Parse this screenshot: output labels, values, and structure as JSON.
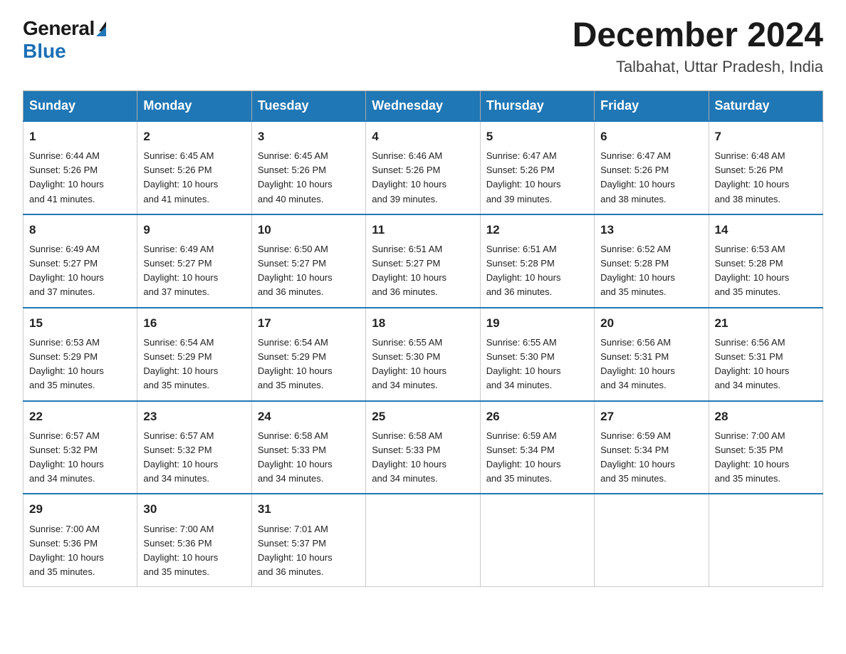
{
  "logo": {
    "general": "General",
    "blue": "Blue",
    "triangle": "▲"
  },
  "title": "December 2024",
  "location": "Talbahat, Uttar Pradesh, India",
  "days_of_week": [
    "Sunday",
    "Monday",
    "Tuesday",
    "Wednesday",
    "Thursday",
    "Friday",
    "Saturday"
  ],
  "weeks": [
    [
      {
        "day": "1",
        "sunrise": "6:44 AM",
        "sunset": "5:26 PM",
        "daylight": "10 hours and 41 minutes."
      },
      {
        "day": "2",
        "sunrise": "6:45 AM",
        "sunset": "5:26 PM",
        "daylight": "10 hours and 41 minutes."
      },
      {
        "day": "3",
        "sunrise": "6:45 AM",
        "sunset": "5:26 PM",
        "daylight": "10 hours and 40 minutes."
      },
      {
        "day": "4",
        "sunrise": "6:46 AM",
        "sunset": "5:26 PM",
        "daylight": "10 hours and 39 minutes."
      },
      {
        "day": "5",
        "sunrise": "6:47 AM",
        "sunset": "5:26 PM",
        "daylight": "10 hours and 39 minutes."
      },
      {
        "day": "6",
        "sunrise": "6:47 AM",
        "sunset": "5:26 PM",
        "daylight": "10 hours and 38 minutes."
      },
      {
        "day": "7",
        "sunrise": "6:48 AM",
        "sunset": "5:26 PM",
        "daylight": "10 hours and 38 minutes."
      }
    ],
    [
      {
        "day": "8",
        "sunrise": "6:49 AM",
        "sunset": "5:27 PM",
        "daylight": "10 hours and 37 minutes."
      },
      {
        "day": "9",
        "sunrise": "6:49 AM",
        "sunset": "5:27 PM",
        "daylight": "10 hours and 37 minutes."
      },
      {
        "day": "10",
        "sunrise": "6:50 AM",
        "sunset": "5:27 PM",
        "daylight": "10 hours and 36 minutes."
      },
      {
        "day": "11",
        "sunrise": "6:51 AM",
        "sunset": "5:27 PM",
        "daylight": "10 hours and 36 minutes."
      },
      {
        "day": "12",
        "sunrise": "6:51 AM",
        "sunset": "5:28 PM",
        "daylight": "10 hours and 36 minutes."
      },
      {
        "day": "13",
        "sunrise": "6:52 AM",
        "sunset": "5:28 PM",
        "daylight": "10 hours and 35 minutes."
      },
      {
        "day": "14",
        "sunrise": "6:53 AM",
        "sunset": "5:28 PM",
        "daylight": "10 hours and 35 minutes."
      }
    ],
    [
      {
        "day": "15",
        "sunrise": "6:53 AM",
        "sunset": "5:29 PM",
        "daylight": "10 hours and 35 minutes."
      },
      {
        "day": "16",
        "sunrise": "6:54 AM",
        "sunset": "5:29 PM",
        "daylight": "10 hours and 35 minutes."
      },
      {
        "day": "17",
        "sunrise": "6:54 AM",
        "sunset": "5:29 PM",
        "daylight": "10 hours and 35 minutes."
      },
      {
        "day": "18",
        "sunrise": "6:55 AM",
        "sunset": "5:30 PM",
        "daylight": "10 hours and 34 minutes."
      },
      {
        "day": "19",
        "sunrise": "6:55 AM",
        "sunset": "5:30 PM",
        "daylight": "10 hours and 34 minutes."
      },
      {
        "day": "20",
        "sunrise": "6:56 AM",
        "sunset": "5:31 PM",
        "daylight": "10 hours and 34 minutes."
      },
      {
        "day": "21",
        "sunrise": "6:56 AM",
        "sunset": "5:31 PM",
        "daylight": "10 hours and 34 minutes."
      }
    ],
    [
      {
        "day": "22",
        "sunrise": "6:57 AM",
        "sunset": "5:32 PM",
        "daylight": "10 hours and 34 minutes."
      },
      {
        "day": "23",
        "sunrise": "6:57 AM",
        "sunset": "5:32 PM",
        "daylight": "10 hours and 34 minutes."
      },
      {
        "day": "24",
        "sunrise": "6:58 AM",
        "sunset": "5:33 PM",
        "daylight": "10 hours and 34 minutes."
      },
      {
        "day": "25",
        "sunrise": "6:58 AM",
        "sunset": "5:33 PM",
        "daylight": "10 hours and 34 minutes."
      },
      {
        "day": "26",
        "sunrise": "6:59 AM",
        "sunset": "5:34 PM",
        "daylight": "10 hours and 35 minutes."
      },
      {
        "day": "27",
        "sunrise": "6:59 AM",
        "sunset": "5:34 PM",
        "daylight": "10 hours and 35 minutes."
      },
      {
        "day": "28",
        "sunrise": "7:00 AM",
        "sunset": "5:35 PM",
        "daylight": "10 hours and 35 minutes."
      }
    ],
    [
      {
        "day": "29",
        "sunrise": "7:00 AM",
        "sunset": "5:36 PM",
        "daylight": "10 hours and 35 minutes."
      },
      {
        "day": "30",
        "sunrise": "7:00 AM",
        "sunset": "5:36 PM",
        "daylight": "10 hours and 35 minutes."
      },
      {
        "day": "31",
        "sunrise": "7:01 AM",
        "sunset": "5:37 PM",
        "daylight": "10 hours and 36 minutes."
      },
      null,
      null,
      null,
      null
    ]
  ],
  "labels": {
    "sunrise": "Sunrise:",
    "sunset": "Sunset:",
    "daylight": "Daylight:"
  }
}
